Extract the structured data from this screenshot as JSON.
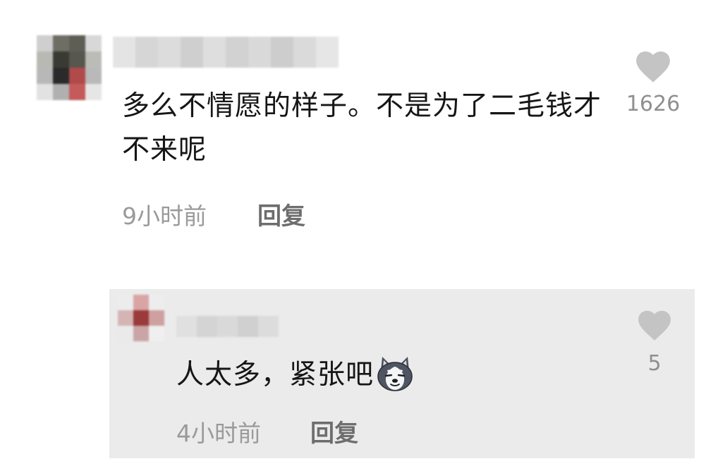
{
  "comment": {
    "text": "多么不情愿的样子。不是为了二毛钱才不来呢",
    "time": "9小时前",
    "reply_label": "回复",
    "like_count": "1626"
  },
  "reply": {
    "text": "人太多，紧张吧",
    "emoji": "husky-face-emoji",
    "time": "4小时前",
    "reply_label": "回复",
    "like_count": "5"
  },
  "colors": {
    "text": "#161616",
    "meta": "#9a9a9a",
    "reply_bg": "#ebebeb",
    "heart": "#c4c4c4"
  }
}
